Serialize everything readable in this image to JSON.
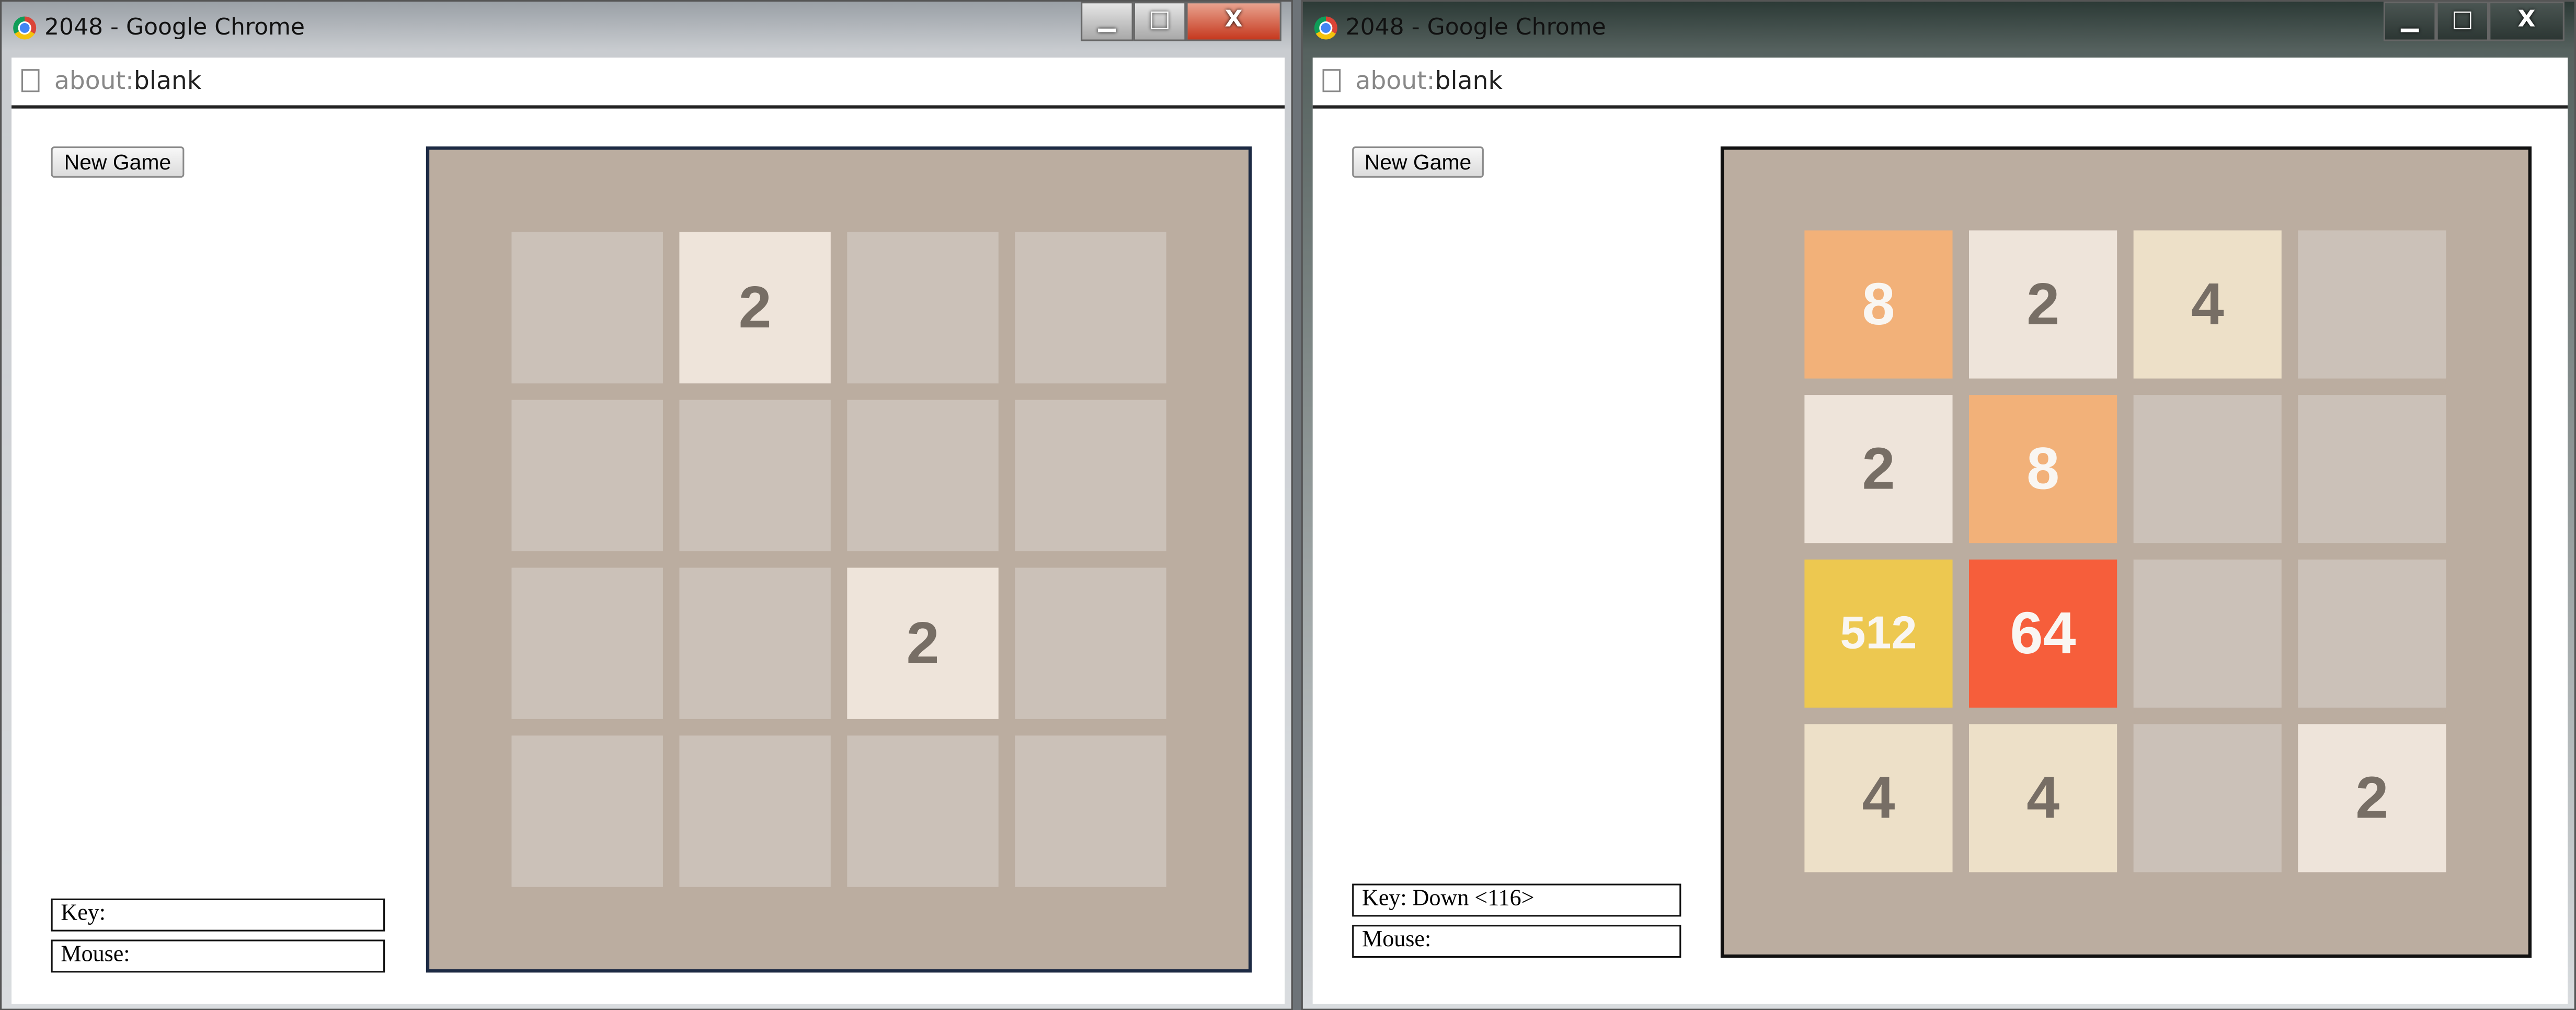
{
  "windows": [
    {
      "title": "2048 - Google Chrome",
      "url_scheme": "about:",
      "url_rest": "blank",
      "new_game_label": "New Game",
      "key_label": "Key:",
      "mouse_label": "Mouse:",
      "grid": [
        [
          0,
          2,
          0,
          0
        ],
        [
          0,
          0,
          0,
          0
        ],
        [
          0,
          0,
          2,
          0
        ],
        [
          0,
          0,
          0,
          0
        ]
      ]
    },
    {
      "title": "2048 - Google Chrome",
      "url_scheme": "about:",
      "url_rest": "blank",
      "new_game_label": "New Game",
      "key_label": "Key: Down <116>",
      "mouse_label": "Mouse:",
      "grid": [
        [
          8,
          2,
          4,
          0
        ],
        [
          2,
          8,
          0,
          0
        ],
        [
          512,
          64,
          0,
          0
        ],
        [
          4,
          4,
          0,
          2
        ]
      ]
    }
  ],
  "window_controls": {
    "minimize": "▁",
    "maximize": "□",
    "close": "X"
  },
  "tile_colors": {
    "0": "#cbc1b8",
    "2": "#eee4da",
    "4": "#ede0c8",
    "8": "#f2b179",
    "64": "#f65e3b",
    "512": "#edc850"
  },
  "tile_text_light": "#f9f6f2",
  "tile_text_dark": "#776e65"
}
